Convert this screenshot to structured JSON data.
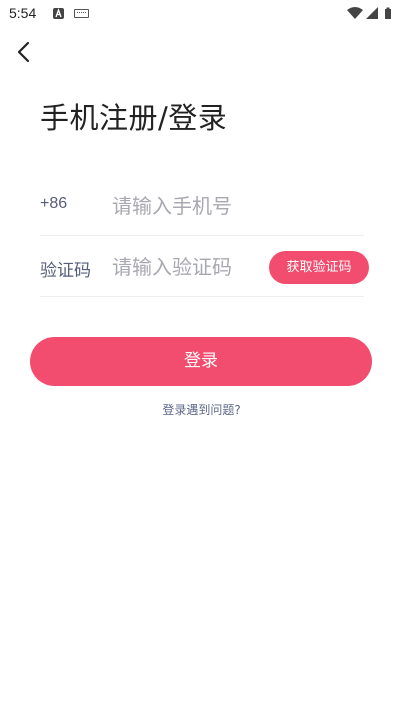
{
  "status_bar": {
    "time": "5:54"
  },
  "header": {
    "title": "手机注册/登录"
  },
  "phone_row": {
    "prefix": "+86",
    "placeholder": "请输入手机号"
  },
  "code_row": {
    "label": "验证码",
    "placeholder": "请输入验证码",
    "get_code_label": "获取验证码"
  },
  "login_button": {
    "label": "登录"
  },
  "trouble_link": {
    "label": "登录遇到问题?"
  },
  "colors": {
    "accent": "#f24d6e",
    "label": "#555e7a",
    "placeholder": "#a8a8b0"
  },
  "icons": {
    "back": "chevron-left-icon",
    "wifi": "wifi-icon",
    "signal": "signal-icon",
    "battery": "battery-icon",
    "keyboard": "keyboard-icon",
    "notification": "a-letter-icon"
  }
}
